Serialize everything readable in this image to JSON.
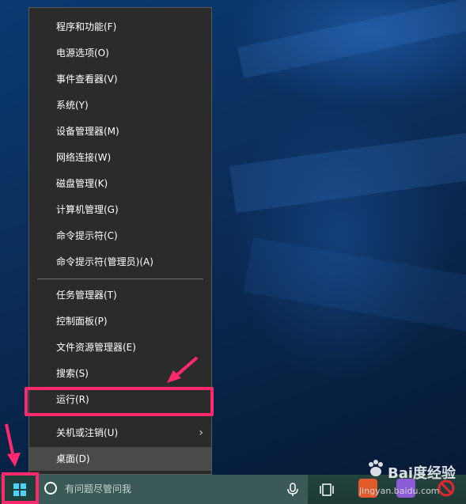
{
  "context_menu": {
    "items": [
      {
        "label": "程序和功能(F)"
      },
      {
        "label": "电源选项(O)"
      },
      {
        "label": "事件查看器(V)"
      },
      {
        "label": "系统(Y)"
      },
      {
        "label": "设备管理器(M)"
      },
      {
        "label": "网络连接(W)"
      },
      {
        "label": "磁盘管理(K)"
      },
      {
        "label": "计算机管理(G)"
      },
      {
        "label": "命令提示符(C)"
      },
      {
        "label": "命令提示符(管理员)(A)"
      },
      {
        "label": "任务管理器(T)"
      },
      {
        "label": "控制面板(P)"
      },
      {
        "label": "文件资源管理器(E)"
      },
      {
        "label": "搜索(S)"
      },
      {
        "label": "运行(R)"
      },
      {
        "label": "关机或注销(U)"
      },
      {
        "label": "桌面(D)"
      }
    ]
  },
  "taskbar": {
    "search_placeholder": "有问题尽管问我",
    "icons": [
      "windows-logo-icon",
      "cortana-icon",
      "microphone-icon",
      "task-view-icon"
    ]
  },
  "watermark": {
    "brand": "Bai度经验",
    "url": "jingyan.baidu.com"
  },
  "annotation_color": "#ff2a6d",
  "accent_color": "#4fd1ff"
}
